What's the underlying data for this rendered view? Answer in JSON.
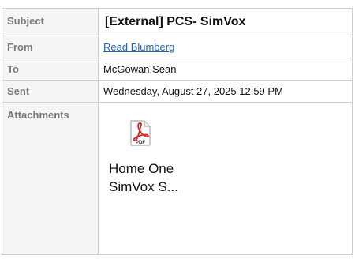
{
  "email": {
    "subject_label": "Subject",
    "subject_value": "[External]  PCS- SimVox",
    "from_label": "From",
    "from_value": "Read Blumberg",
    "to_label": "To",
    "to_value": "McGowan,Sean",
    "sent_label": "Sent",
    "sent_value": "Wednesday, August 27, 2025 12:59 PM",
    "attachments_label": "Attachments",
    "attachment": {
      "icon": "pdf-icon",
      "icon_text": "PDF",
      "name_line1": "Home One",
      "name_line2": "SimVox S..."
    }
  },
  "colors": {
    "pdf_red": "#d9252a",
    "link_blue": "#1f5fb8",
    "label_gray": "#7a7a7a",
    "border": "#cfcfcf"
  }
}
